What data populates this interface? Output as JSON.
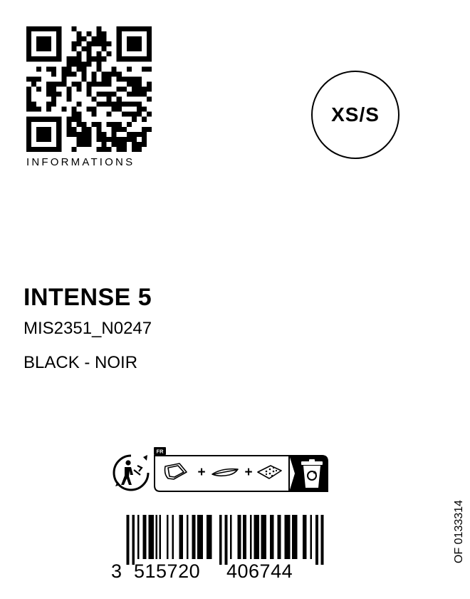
{
  "qr": {
    "label": "INFORMATIONS"
  },
  "size_badge": {
    "text": "XS/S"
  },
  "product": {
    "name": "INTENSE 5",
    "reference": "MIS2351_N0247",
    "color": "BLACK - NOIR"
  },
  "sorting_info": {
    "country_code": "FR",
    "plus_1": "+",
    "plus_2": "+",
    "icons": [
      "packaging-bag-icon",
      "paper-tag-icon",
      "sticker-icon",
      "recycling-bin-icon",
      "triman-icon"
    ]
  },
  "barcode": {
    "digit_first": "3",
    "group_left": "515720",
    "group_right": "406744"
  },
  "footer": {
    "of_code": "OF 0133314"
  }
}
